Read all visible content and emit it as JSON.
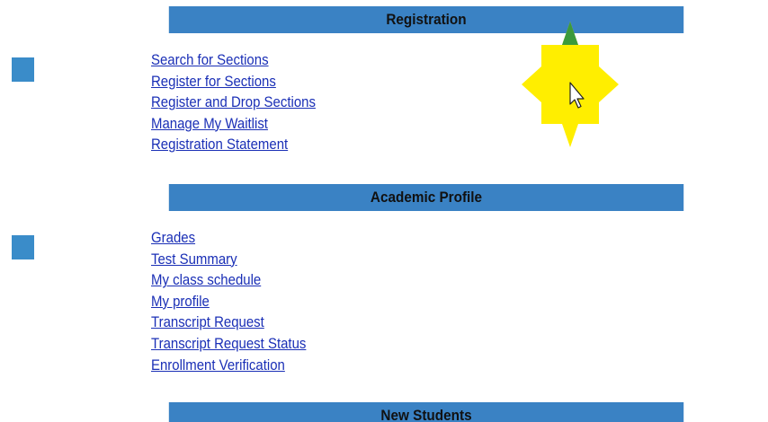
{
  "registration": {
    "title": "Registration",
    "links": [
      "Search for Sections",
      "Register for Sections",
      "Register and Drop Sections",
      "Manage My Waitlist",
      "Registration Statement"
    ]
  },
  "academic_profile": {
    "title": "Academic Profile",
    "links": [
      "Grades",
      "Test Summary",
      "My class schedule",
      "My profile",
      "Transcript Request",
      "Transcript Request Status",
      "Enrollment Verification"
    ]
  },
  "new_students": {
    "title": "New Students"
  },
  "colors": {
    "header_bg": "#3a82c4",
    "link": "#1a2fb6",
    "square": "#3a8cc9",
    "cursor_highlight": "#ffee00"
  }
}
